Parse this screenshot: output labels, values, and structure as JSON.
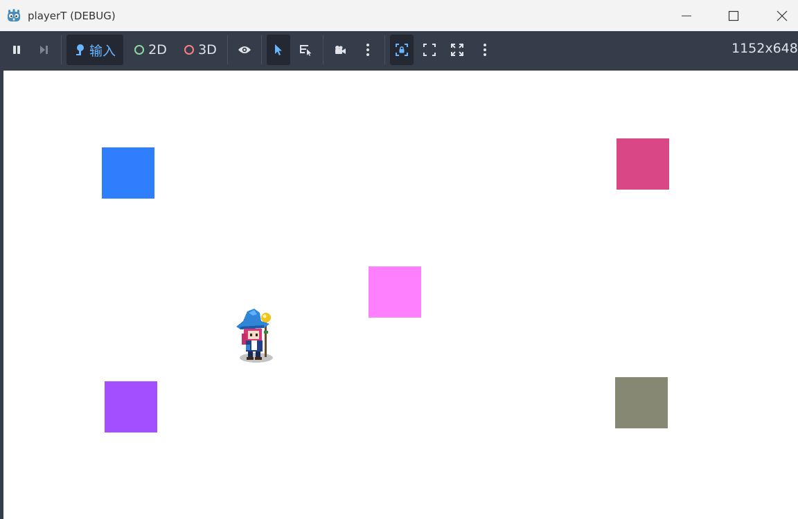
{
  "window": {
    "title": "playerT (DEBUG)",
    "app_icon": "godot-icon",
    "controls": {
      "minimize": "minimize-icon",
      "maximize": "maximize-icon",
      "close": "close-icon"
    }
  },
  "toolbar": {
    "input_label": "输入",
    "mode_2d_label": "2D",
    "mode_3d_label": "3D",
    "resolution": "1152x648",
    "icons": [
      "pause-icon",
      "step-icon",
      "input-icon",
      "eye-icon",
      "select-arrow-icon",
      "list-select-icon",
      "camera-icon",
      "more-icon",
      "camera-lock-icon",
      "fit-screen-icon",
      "fullscreen-icon",
      "more-icon"
    ]
  },
  "colors": {
    "viewport_bg": "#ffffff",
    "square_blue": "#2f7ffd",
    "square_crimson": "#d94787",
    "square_pink": "#ff80ff",
    "square_purple": "#a44fff",
    "square_olive": "#868874",
    "accent_2d": "#8ed9a2",
    "accent_3d": "#fc7f7f"
  },
  "scene": {
    "objects": [
      "blue-square",
      "crimson-square",
      "pink-square",
      "purple-square",
      "olive-square",
      "wizard-sprite"
    ]
  }
}
